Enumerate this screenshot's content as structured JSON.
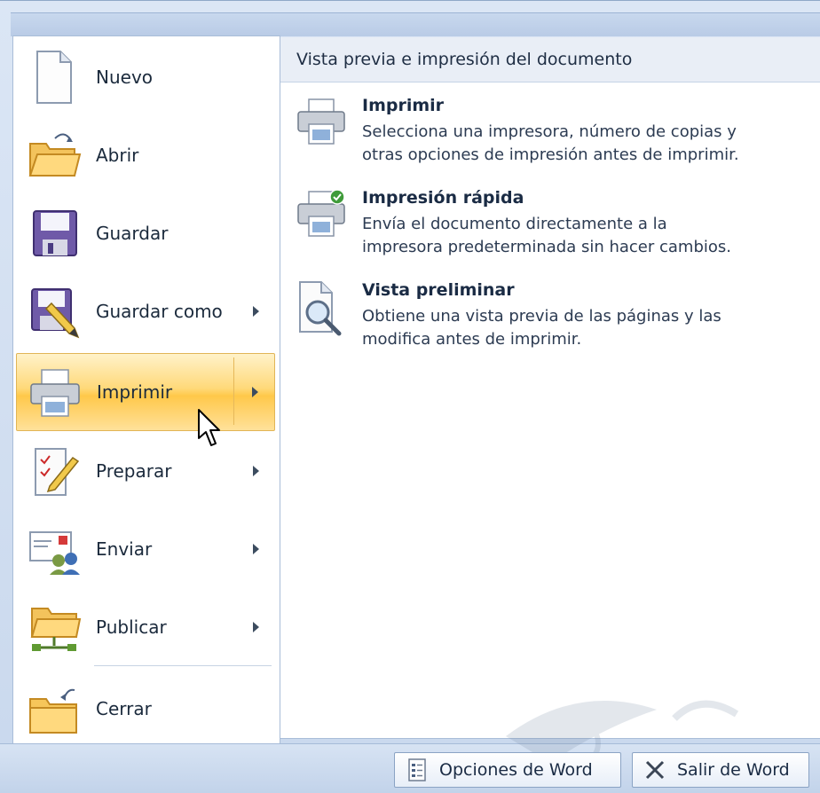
{
  "menu": {
    "items": [
      {
        "label": "Nuevo",
        "icon": "new-document-icon",
        "has_submenu": false
      },
      {
        "label": "Abrir",
        "icon": "open-folder-icon",
        "has_submenu": false
      },
      {
        "label": "Guardar",
        "icon": "save-disk-icon",
        "has_submenu": false
      },
      {
        "label": "Guardar como",
        "icon": "save-as-icon",
        "has_submenu": true
      },
      {
        "label": "Imprimir",
        "icon": "printer-icon",
        "has_submenu": true,
        "selected": true
      },
      {
        "label": "Preparar",
        "icon": "prepare-document-icon",
        "has_submenu": true
      },
      {
        "label": "Enviar",
        "icon": "send-icon",
        "has_submenu": true
      },
      {
        "label": "Publicar",
        "icon": "publish-folder-icon",
        "has_submenu": true
      },
      {
        "label": "Cerrar",
        "icon": "close-folder-icon",
        "has_submenu": false
      }
    ]
  },
  "panel": {
    "title": "Vista previa e impresión del documento",
    "options": [
      {
        "title": "Imprimir",
        "line1": "Selecciona una impresora, número de copias y",
        "line2": "otras opciones de impresión antes de imprimir.",
        "icon": "printer-icon"
      },
      {
        "title": "Impresión rápida",
        "line1": "Envía el documento directamente a la",
        "line2": "impresora predeterminada sin hacer cambios.",
        "icon": "quick-print-icon"
      },
      {
        "title": "Vista preliminar",
        "line1": "Obtiene una vista previa de las páginas y las",
        "line2": "modifica antes de imprimir.",
        "icon": "print-preview-icon"
      }
    ]
  },
  "footer": {
    "options_label": "Opciones de Word",
    "exit_label": "Salir de Word"
  },
  "colors": {
    "selected_top": "#fff2c9",
    "selected_bottom": "#ffc84a",
    "frame": "#cfdcee"
  }
}
